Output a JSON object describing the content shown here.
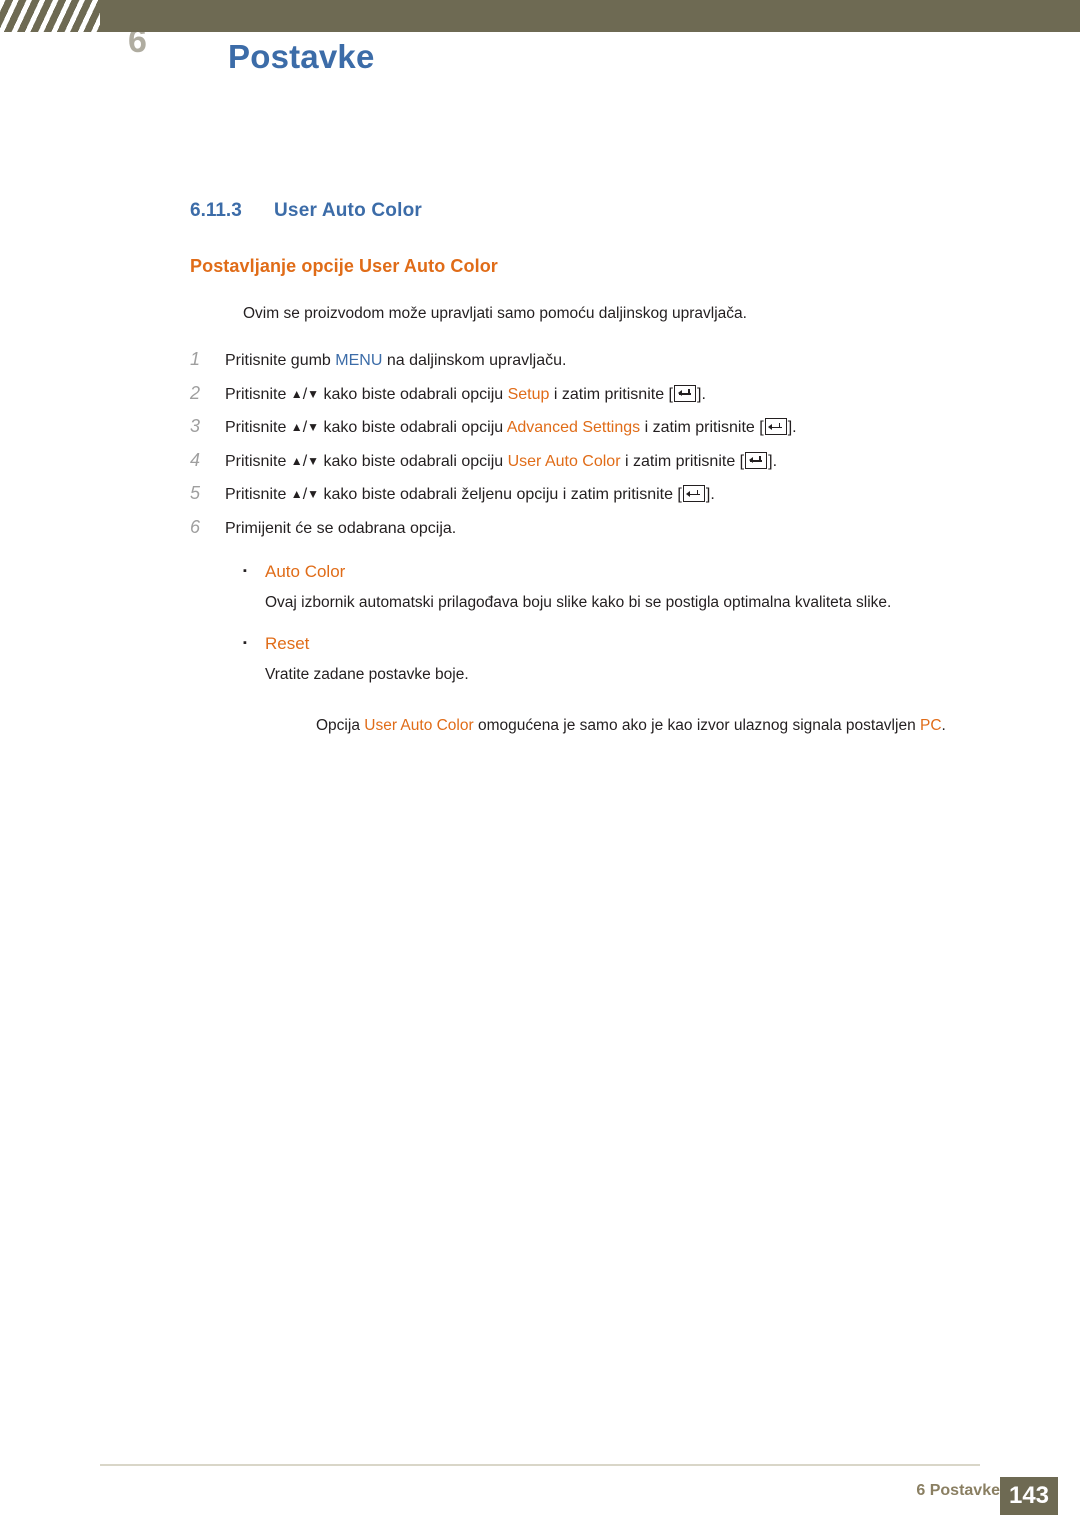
{
  "header": {
    "chapter_number": "6",
    "title": "Postavke"
  },
  "section": {
    "number": "6.11.3",
    "title": "User Auto Color",
    "subsection": "Postavljanje opcije User Auto Color",
    "note": "Ovim se proizvodom može upravljati samo pomoću daljinskog upravljača."
  },
  "steps": [
    {
      "num": "1",
      "parts": [
        {
          "t": "Pritisnite gumb ",
          "style": "plain"
        },
        {
          "t": "MENU",
          "style": "blue"
        },
        {
          "t": " na daljinskom upravljaču.",
          "style": "plain"
        }
      ]
    },
    {
      "num": "2",
      "parts": [
        {
          "t": "Pritisnite ",
          "style": "plain"
        },
        {
          "t": "▲",
          "style": "arrow"
        },
        {
          "t": "/",
          "style": "plain"
        },
        {
          "t": "▼",
          "style": "arrow"
        },
        {
          "t": " kako biste odabrali opciju ",
          "style": "plain"
        },
        {
          "t": "Setup",
          "style": "orange"
        },
        {
          "t": " i zatim pritisnite [",
          "style": "plain"
        },
        {
          "t": "enter-key",
          "style": "key"
        },
        {
          "t": "].",
          "style": "plain"
        }
      ]
    },
    {
      "num": "3",
      "parts": [
        {
          "t": "Pritisnite ",
          "style": "plain"
        },
        {
          "t": "▲",
          "style": "arrow"
        },
        {
          "t": "/",
          "style": "plain"
        },
        {
          "t": "▼",
          "style": "arrow"
        },
        {
          "t": " kako biste odabrali opciju ",
          "style": "plain"
        },
        {
          "t": "Advanced Settings",
          "style": "orange"
        },
        {
          "t": " i zatim pritisnite [",
          "style": "plain"
        },
        {
          "t": "enter-key",
          "style": "key"
        },
        {
          "t": "].",
          "style": "plain"
        }
      ]
    },
    {
      "num": "4",
      "parts": [
        {
          "t": "Pritisnite ",
          "style": "plain"
        },
        {
          "t": "▲",
          "style": "arrow"
        },
        {
          "t": "/",
          "style": "plain"
        },
        {
          "t": "▼",
          "style": "arrow"
        },
        {
          "t": " kako biste odabrali opciju ",
          "style": "plain"
        },
        {
          "t": "User Auto Color",
          "style": "orange"
        },
        {
          "t": " i zatim pritisnite [",
          "style": "plain"
        },
        {
          "t": "enter-key",
          "style": "key"
        },
        {
          "t": "].",
          "style": "plain"
        }
      ]
    },
    {
      "num": "5",
      "parts": [
        {
          "t": "Pritisnite ",
          "style": "plain"
        },
        {
          "t": "▲",
          "style": "arrow"
        },
        {
          "t": "/",
          "style": "plain"
        },
        {
          "t": "▼",
          "style": "arrow"
        },
        {
          "t": " kako biste odabrali željenu opciju i zatim pritisnite [",
          "style": "plain"
        },
        {
          "t": "enter-key",
          "style": "key"
        },
        {
          "t": "].",
          "style": "plain"
        }
      ]
    },
    {
      "num": "6",
      "parts": [
        {
          "t": "Primijenit će se odabrana opcija.",
          "style": "plain"
        }
      ]
    }
  ],
  "options": [
    {
      "label": "Auto Color",
      "body": "Ovaj izbornik automatski prilagođava boju slike kako bi se postigla optimalna kvaliteta slike."
    },
    {
      "label": "Reset",
      "body": "Vratite zadane postavke boje."
    }
  ],
  "footnote": {
    "parts": [
      {
        "t": "Opcija ",
        "style": "plain"
      },
      {
        "t": "User Auto Color",
        "style": "orange"
      },
      {
        "t": " omogućena je samo ako je kao izvor ulaznog signala postavljen ",
        "style": "plain"
      },
      {
        "t": "PC",
        "style": "orange"
      },
      {
        "t": ".",
        "style": "plain"
      }
    ]
  },
  "footer": {
    "label": "6 Postavke",
    "page": "143"
  }
}
